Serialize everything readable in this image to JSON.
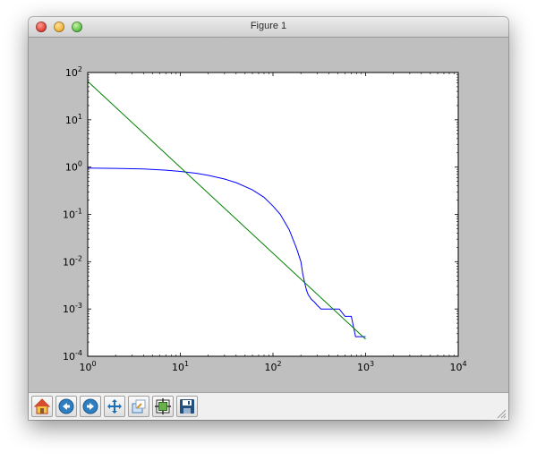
{
  "window": {
    "title": "Figure 1"
  },
  "toolbar": {
    "buttons": [
      {
        "icon": "home-icon"
      },
      {
        "icon": "back-icon"
      },
      {
        "icon": "forward-icon"
      },
      {
        "icon": "pan-icon"
      },
      {
        "icon": "zoom-icon"
      },
      {
        "icon": "subplots-icon"
      },
      {
        "icon": "save-icon"
      }
    ]
  },
  "chart_data": {
    "type": "line",
    "xscale": "log",
    "yscale": "log",
    "xlim": [
      1,
      10000
    ],
    "ylim": [
      0.0001,
      100
    ],
    "x_ticks": [
      {
        "base": "10",
        "exp": "0"
      },
      {
        "base": "10",
        "exp": "1"
      },
      {
        "base": "10",
        "exp": "2"
      },
      {
        "base": "10",
        "exp": "3"
      },
      {
        "base": "10",
        "exp": "4"
      }
    ],
    "y_ticks": [
      {
        "base": "10",
        "exp": "-4"
      },
      {
        "base": "10",
        "exp": "-3"
      },
      {
        "base": "10",
        "exp": "-2"
      },
      {
        "base": "10",
        "exp": "-1"
      },
      {
        "base": "10",
        "exp": "0"
      },
      {
        "base": "10",
        "exp": "1"
      },
      {
        "base": "10",
        "exp": "2"
      }
    ],
    "series": [
      {
        "color": "#0000ff",
        "x": [
          1,
          2,
          4,
          7,
          10,
          15,
          20,
          30,
          40,
          60,
          80,
          100,
          120,
          150,
          180,
          200,
          210,
          220,
          230,
          240,
          260,
          280,
          300,
          330,
          360,
          400,
          450,
          520,
          600,
          700,
          780,
          1000
        ],
        "y": [
          0.95,
          0.94,
          0.91,
          0.86,
          0.81,
          0.74,
          0.67,
          0.56,
          0.47,
          0.33,
          0.23,
          0.15,
          0.1,
          0.047,
          0.019,
          0.01,
          0.0055,
          0.0036,
          0.0025,
          0.002,
          0.0016,
          0.0014,
          0.0012,
          0.001,
          0.001,
          0.001,
          0.001,
          0.001,
          0.0007,
          0.0007,
          0.00026,
          0.00026
        ]
      },
      {
        "color": "#008000",
        "x": [
          1,
          1000
        ],
        "y": [
          65,
          0.00023
        ]
      }
    ]
  }
}
